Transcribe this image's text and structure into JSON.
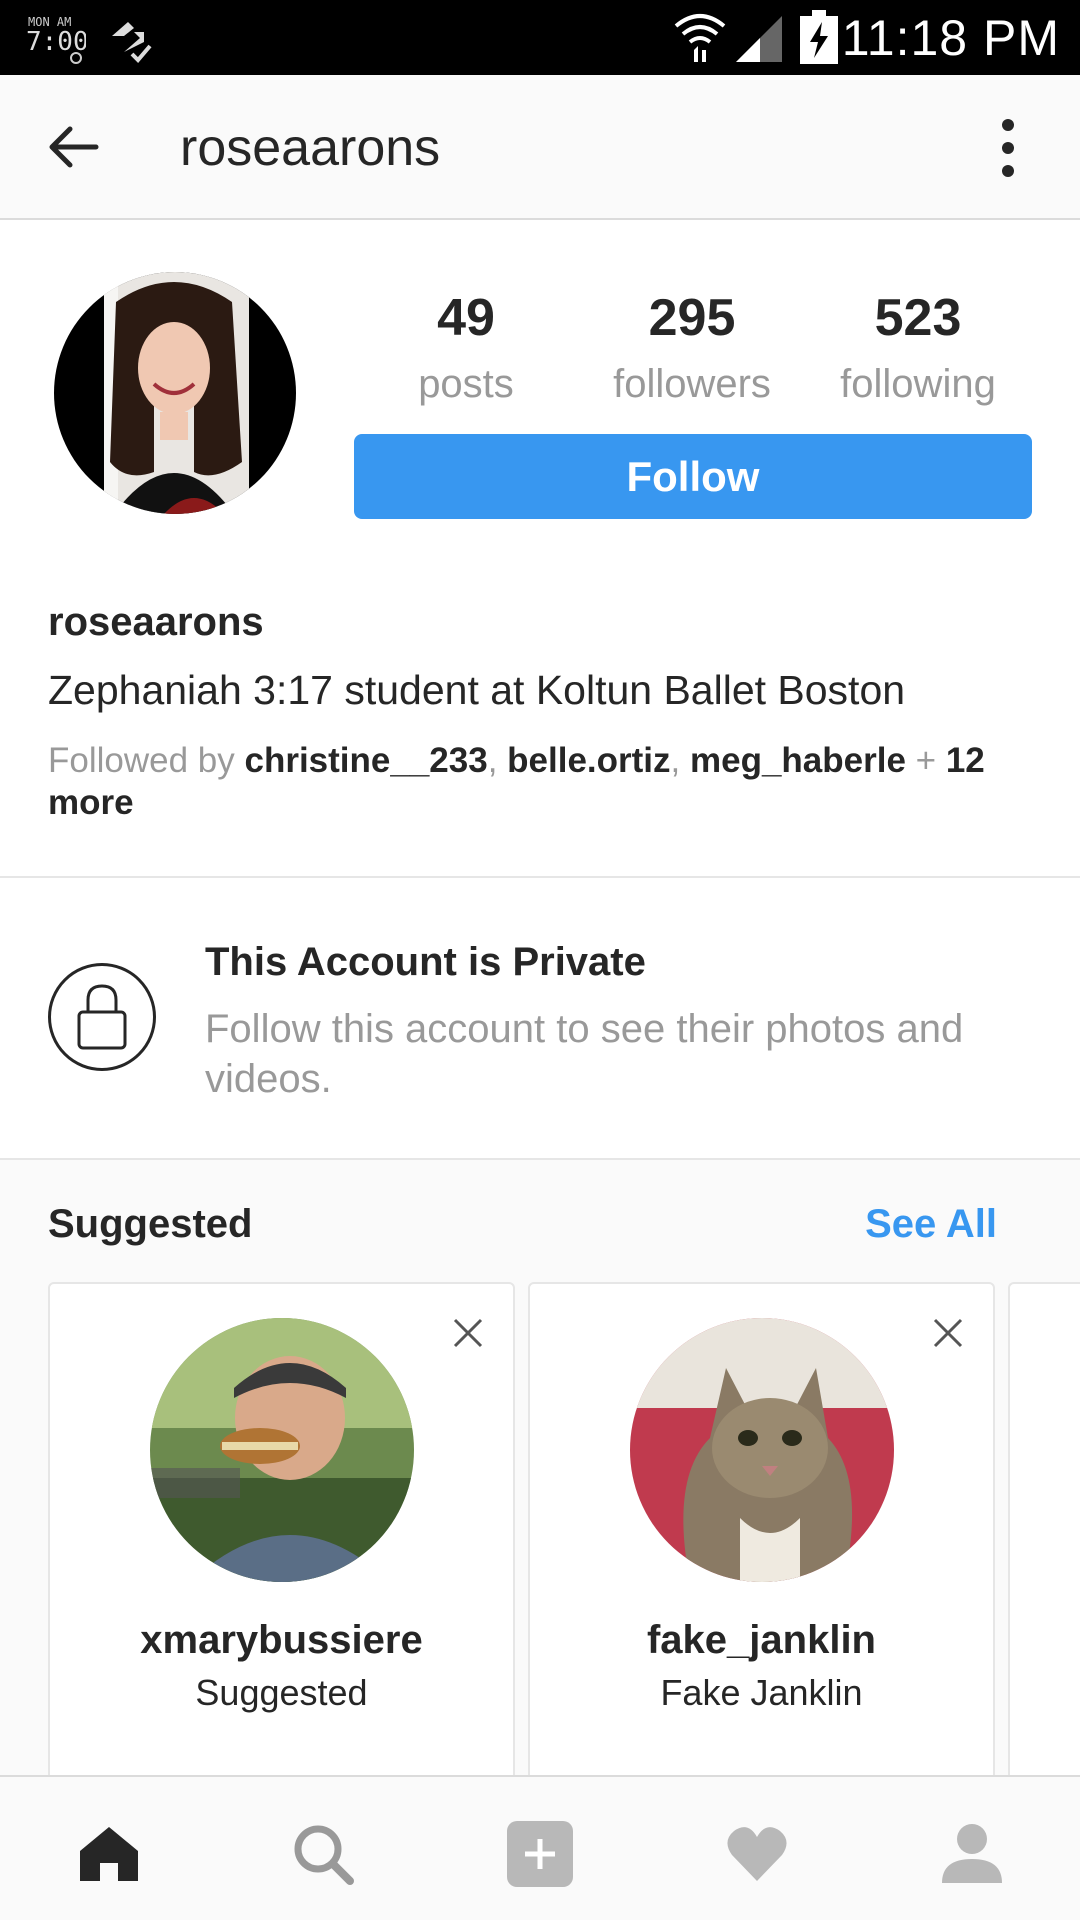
{
  "status_bar": {
    "time": "11:18 PM",
    "icons": [
      "clock-alarm-icon",
      "sync-icon",
      "wifi-icon",
      "signal-icon",
      "battery-charging-icon"
    ]
  },
  "header": {
    "title": "roseaarons",
    "icons": [
      "back-arrow-icon",
      "more-vertical-icon"
    ]
  },
  "profile": {
    "stats": [
      {
        "value": "49",
        "label": "posts"
      },
      {
        "value": "295",
        "label": "followers"
      },
      {
        "value": "523",
        "label": "following"
      }
    ],
    "follow_label": "Follow",
    "username": "roseaarons",
    "bio": "Zephaniah 3:17 student at Koltun Ballet Boston",
    "followed_by": {
      "prefix": "Followed by ",
      "users": [
        "christine__233",
        "belle.ortiz",
        "meg_haberle"
      ],
      "suffix_plus": " + ",
      "more": "12 more"
    }
  },
  "private": {
    "title": "This Account is Private",
    "text": "Follow this account to see their photos and videos."
  },
  "suggested": {
    "title": "Suggested",
    "see_all": "See All",
    "cards": [
      {
        "username": "xmarybussiere",
        "subtitle": "Suggested"
      },
      {
        "username": "fake_janklin",
        "subtitle": "Fake Janklin"
      }
    ]
  },
  "bottom_nav": [
    "home-icon",
    "search-icon",
    "add-post-icon",
    "activity-heart-icon",
    "profile-icon"
  ],
  "colors": {
    "accent": "#3897f0",
    "text": "#262626",
    "muted": "#999999",
    "background": "#fafafa"
  }
}
